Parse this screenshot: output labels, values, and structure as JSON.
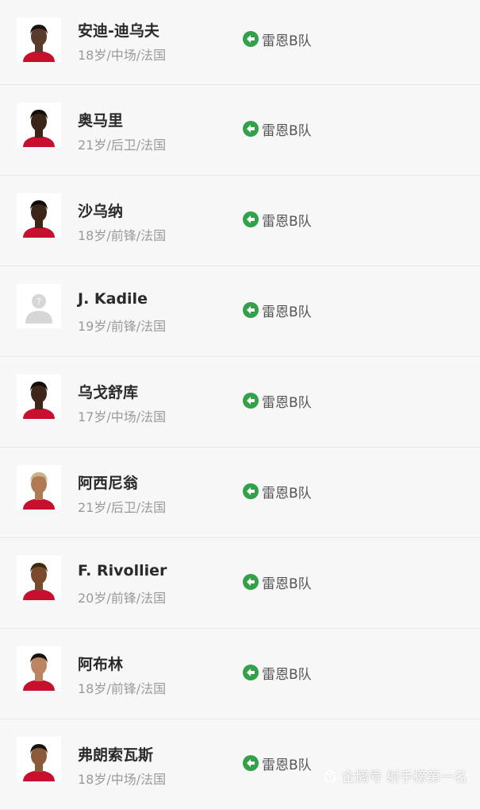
{
  "players": [
    {
      "name": "安迪-迪乌夫",
      "meta": "18岁/中场/法国",
      "team": "雷恩B队",
      "avatar": "photo",
      "skin": "#5a3a2a",
      "hair": "#1a1410"
    },
    {
      "name": "奥马里",
      "meta": "21岁/后卫/法国",
      "team": "雷恩B队",
      "avatar": "photo",
      "skin": "#3b2418",
      "hair": "#120c08"
    },
    {
      "name": "沙乌纳",
      "meta": "18岁/前锋/法国",
      "team": "雷恩B队",
      "avatar": "photo",
      "skin": "#3d2619",
      "hair": "#100a06"
    },
    {
      "name": "J. Kadile",
      "meta": "19岁/前锋/法国",
      "team": "雷恩B队",
      "avatar": "placeholder",
      "skin": "#d9d9d9",
      "hair": "#d9d9d9"
    },
    {
      "name": "乌戈舒库",
      "meta": "17岁/中场/法国",
      "team": "雷恩B队",
      "avatar": "photo",
      "skin": "#3e271a",
      "hair": "#120c08"
    },
    {
      "name": "阿西尼翁",
      "meta": "21岁/后卫/法国",
      "team": "雷恩B队",
      "avatar": "photo",
      "skin": "#b07a55",
      "hair": "#c9b48a"
    },
    {
      "name": "F. Rivollier",
      "meta": "20岁/前锋/法国",
      "team": "雷恩B队",
      "avatar": "photo",
      "skin": "#7a4a2e",
      "hair": "#3a2a10"
    },
    {
      "name": "阿布林",
      "meta": "18岁/前锋/法国",
      "team": "雷恩B队",
      "avatar": "photo",
      "skin": "#b98563",
      "hair": "#1a120c"
    },
    {
      "name": "弗朗索瓦斯",
      "meta": "18岁/中场/法国",
      "team": "雷恩B队",
      "avatar": "photo",
      "skin": "#8a5a3a",
      "hair": "#1a120c"
    }
  ],
  "icons": {
    "transfer": "back-arrow-circle-icon",
    "placeholder": "user-placeholder-icon"
  },
  "colors": {
    "transfer_green": "#33a04a",
    "kit_red": "#c8102e"
  },
  "watermark": {
    "text": "企鹅号 射手榜第一名"
  }
}
